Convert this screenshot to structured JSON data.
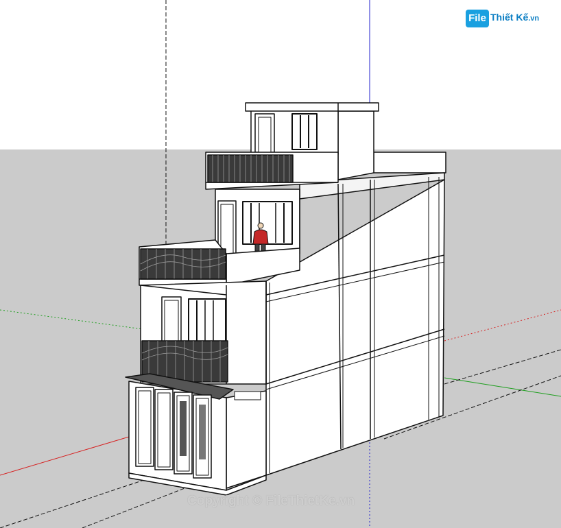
{
  "logo": {
    "badge": "File",
    "name": "Thiết Kế",
    "tld": ".vn"
  },
  "watermark": {
    "text": "Copyright © FileThietKe.vn"
  },
  "scene": {
    "sky_color": "#ffffff",
    "ground_color": "#cbcbcb",
    "axis_colors": {
      "red": "#d62020",
      "green": "#1c9e1c",
      "blue": "#2222cc"
    },
    "wall_color": "#ffffff",
    "wall_shade_color": "#f1f1f1",
    "outline_color": "#111111",
    "railing_color": "#3a3a3a",
    "person_color": "#c42828"
  }
}
